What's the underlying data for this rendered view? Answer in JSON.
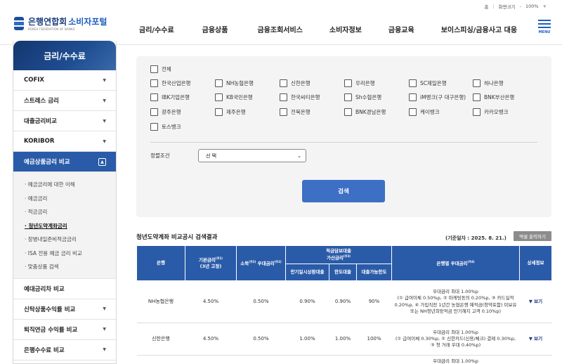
{
  "util": {
    "home": "홈",
    "zoom_label": "화면크기",
    "minus": "-",
    "zoom": "100%",
    "plus": "+"
  },
  "header": {
    "logo_main": "은행연합회",
    "logo_accent": "소비자포털",
    "logo_sub": "KOREA FEDERATION OF BANKS",
    "nav": [
      "금리/수수료",
      "금융상품",
      "금융조회서비스",
      "소비자정보",
      "금융교육",
      "보이스피싱/금융사고 대응"
    ],
    "menu_label": "MENU"
  },
  "sidebar": {
    "title": "금리/수수료",
    "items_top": [
      {
        "label": "COFIX"
      },
      {
        "label": "스트레스 금리"
      },
      {
        "label": "대출금리비교"
      },
      {
        "label": "KORIBOR"
      }
    ],
    "active": {
      "label": "예금상품금리 비교"
    },
    "sub_items": [
      "예금금리에 대한 이해",
      "예금금리",
      "적금금리",
      "청년도약계좌금리",
      "장병내일준비적금금리",
      "ISA 전용 예금 금리 비교",
      "맞춤상품 검색"
    ],
    "sub_current_index": 3,
    "items_bottom": [
      {
        "label": "예대금리차 비교",
        "arrow": false
      },
      {
        "label": "신탁상품수익률 비교",
        "arrow": true
      },
      {
        "label": "퇴직연금 수익률 비교",
        "arrow": true
      },
      {
        "label": "은행수수료 비교",
        "arrow": true
      }
    ]
  },
  "filter": {
    "all_label": "전체",
    "banks": [
      "한국산업은행",
      "NH농협은행",
      "신한은행",
      "우리은행",
      "SC제일은행",
      "하나은행",
      "IBK기업은행",
      "KB국민은행",
      "한국씨티은행",
      "Sh수협은행",
      "iM뱅크(구 대구은행)",
      "BNK부산은행",
      "광주은행",
      "제주은행",
      "전북은행",
      "BNK경남은행",
      "케이뱅크",
      "카카오뱅크",
      "토스뱅크"
    ],
    "sort_label": "정렬조건",
    "sort_value": "선 택",
    "search_button": "검색"
  },
  "results": {
    "title": "청년도약계좌 비교공시 검색결과",
    "date": "(기준일자 : 2025. 8. 21.)",
    "excel_button": "엑셀 출력하기",
    "headers": {
      "bank": "은행",
      "base_rate": "기본금리",
      "base_rate_sup": "(주1)",
      "base_rate_sub": "(3년 고정)",
      "income_pref": "소득",
      "income_pref_sup": "(주2)",
      "income_pref_tail": "우대금리",
      "income_pref_sup2": "(주2)",
      "collateral": "적금담보대출",
      "collateral_sub": "가산금리",
      "collateral_sup": "(주3)",
      "col_a": "만기일시상환대출",
      "col_b": "한도대출",
      "col_c": "대출가능한도",
      "bank_pref": "은행별 우대금리",
      "bank_pref_sup": "(주4)",
      "detail": "상세정보"
    },
    "rows": [
      {
        "bank": "NH농협은행",
        "base": "4.50%",
        "income": "0.50%",
        "a": "0.90%",
        "b": "0.90%",
        "c": "90%",
        "benefit": [
          "우대금리 최대 1.00%p",
          "(① 급여이체 0.50%p, ② 마케팅동의 0.20%p, ③ 카드실적",
          "0.20%p, ④ 가입직전 1년간 농협은행 예적금(청약포함) 미보유",
          "또는 NH청년희망적금 만기해지 고객 0.10%p)"
        ],
        "detail": "▼ 보기"
      },
      {
        "bank": "신한은행",
        "base": "4.50%",
        "income": "0.50%",
        "a": "1.00%",
        "b": "1.00%",
        "c": "100%",
        "benefit": [
          "우대금리 최대 1.00%p",
          "(① 급여이체 0.30%p, ② 신한카드(신용/체크) 결제 0.30%p,",
          "③ 첫 거래 우대 0.40%p)"
        ],
        "detail": "▼ 보기"
      }
    ],
    "next_row_fragment": "우대금리 최대 1.00%p"
  }
}
